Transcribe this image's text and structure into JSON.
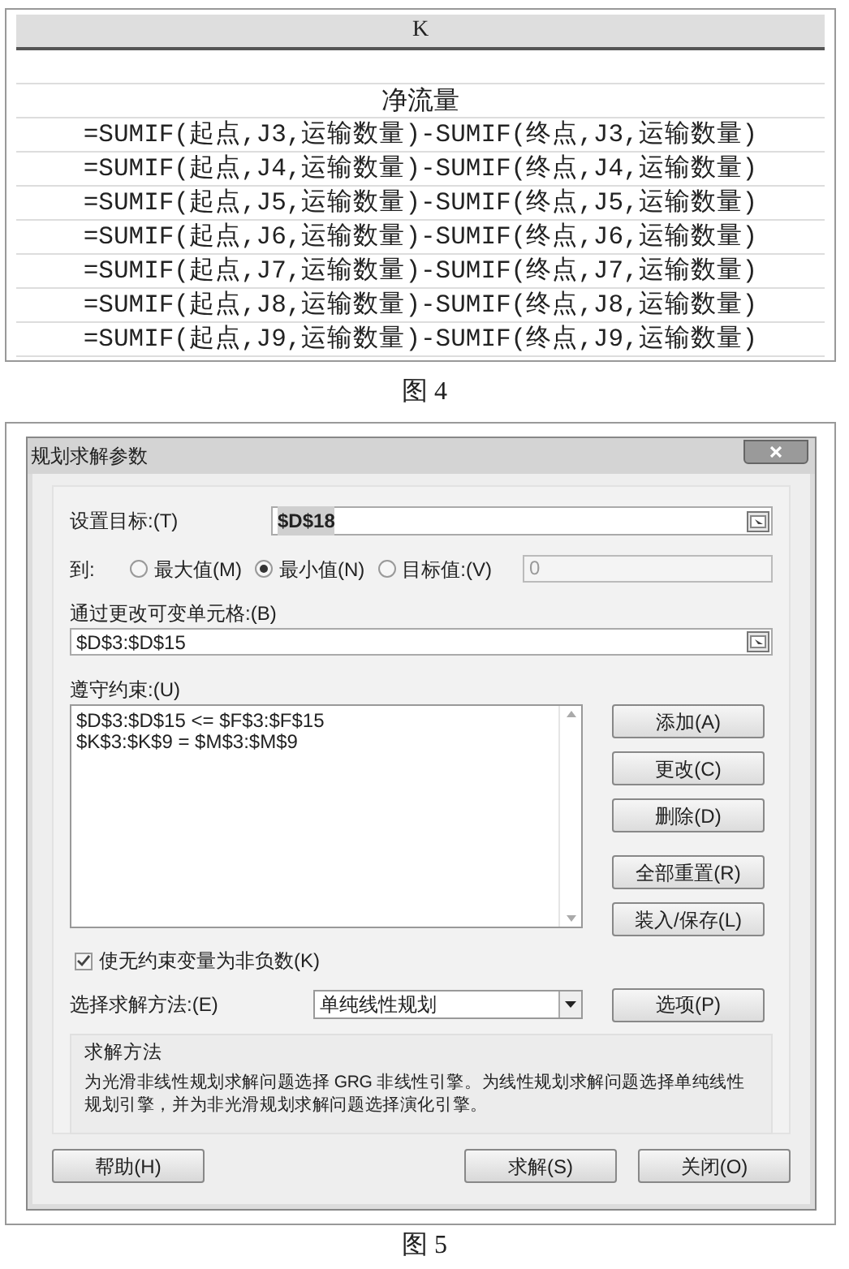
{
  "figure_4": {
    "column_header": "K",
    "heading": "净流量",
    "formulas": [
      "=SUMIF(起点,J3,运输数量)-SUMIF(终点,J3,运输数量)",
      "=SUMIF(起点,J4,运输数量)-SUMIF(终点,J4,运输数量)",
      "=SUMIF(起点,J5,运输数量)-SUMIF(终点,J5,运输数量)",
      "=SUMIF(起点,J6,运输数量)-SUMIF(终点,J6,运输数量)",
      "=SUMIF(起点,J7,运输数量)-SUMIF(终点,J7,运输数量)",
      "=SUMIF(起点,J8,运输数量)-SUMIF(终点,J8,运输数量)",
      "=SUMIF(起点,J9,运输数量)-SUMIF(终点,J9,运输数量)"
    ],
    "caption": "图 4"
  },
  "figure_5": {
    "dialog": {
      "title": "规划求解参数",
      "set_objective": {
        "label": "设置目标:(T)",
        "value": "$D$18"
      },
      "to": {
        "label": "到:",
        "options": [
          {
            "label": "最大值(M)",
            "selected": false
          },
          {
            "label": "最小值(N)",
            "selected": true
          },
          {
            "label": "目标值:(V)",
            "selected": false
          }
        ],
        "target_value": "0"
      },
      "changing_cells": {
        "label": "通过更改可变单元格:(B)",
        "value": "$D$3:$D$15"
      },
      "constraints": {
        "label": "遵守约束:(U)",
        "items": [
          "$D$3:$D$15 <= $F$3:$F$15",
          "$K$3:$K$9 = $M$3:$M$9"
        ]
      },
      "side_buttons": [
        "添加(A)",
        "更改(C)",
        "删除(D)",
        "全部重置(R)",
        "装入/保存(L)"
      ],
      "nonnegative": {
        "label": "使无约束变量为非负数(K)",
        "checked": true
      },
      "method": {
        "label": "选择求解方法:(E)",
        "value": "单纯线性规划"
      },
      "options_button": "选项(P)",
      "method_info": {
        "title": "求解方法",
        "text": "为光滑非线性规划求解问题选择 GRG 非线性引擎。为线性规划求解问题选择单纯线性规划引擎，并为非光滑规划求解问题选择演化引擎。"
      },
      "bottom_buttons": [
        {
          "label": "帮助(H)",
          "kind": "left"
        },
        {
          "label": "求解(S)",
          "kind": "right"
        },
        {
          "label": "关闭(O)",
          "kind": "right"
        }
      ]
    },
    "caption": "图 5"
  }
}
